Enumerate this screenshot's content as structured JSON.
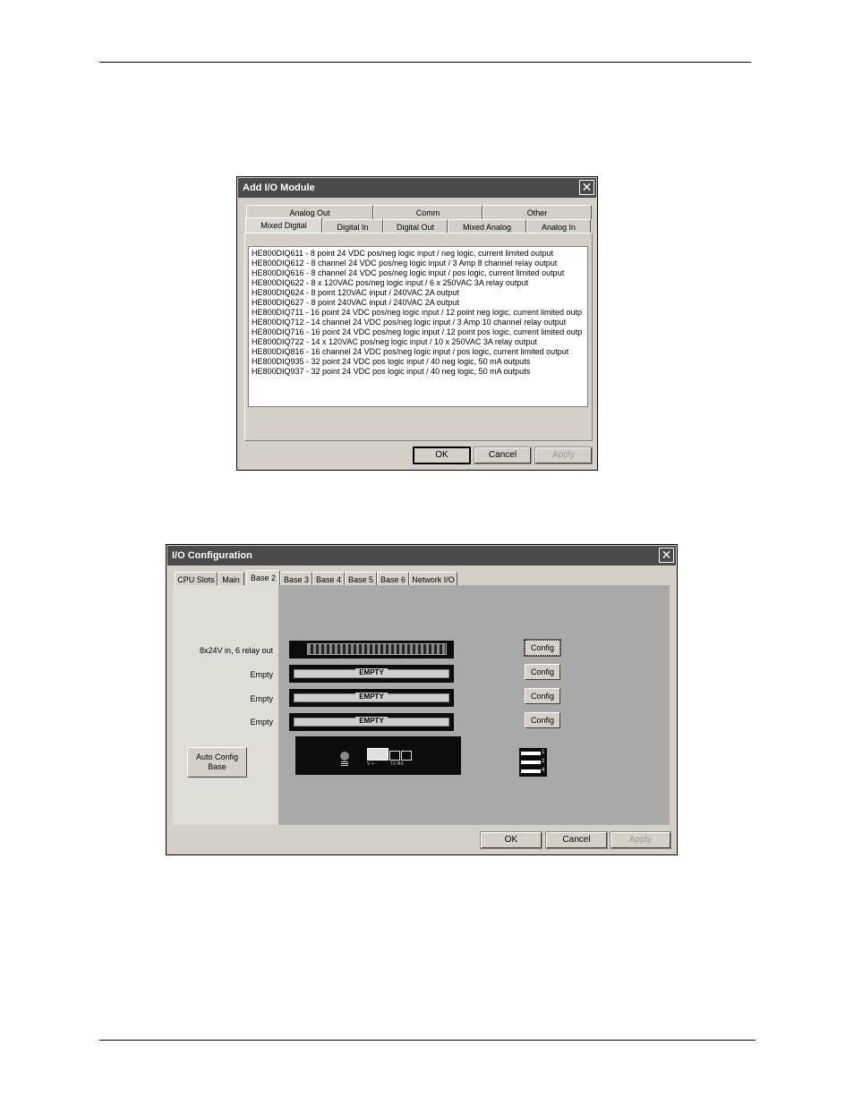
{
  "add_io_module": {
    "title": "Add I/O Module",
    "tabs_back": [
      "Analog Out",
      "Comm",
      "Other"
    ],
    "tabs_front": [
      "Mixed Digital",
      "Digital In",
      "Digital Out",
      "Mixed Analog",
      "Analog In"
    ],
    "active_tab": "Mixed Digital",
    "modules": [
      "HE800DIQ611  -  8 point 24 VDC pos/neg logic input / neg logic, current limited output",
      "HE800DIQ612  -  8 channel 24 VDC pos/neg logic input / 3 Amp 8 channel relay output",
      "HE800DIQ616  -  8 channel 24 VDC pos/neg logic input / pos logic, current limited output",
      "HE800DIQ622  -  8 x 120VAC pos/neg logic input / 6 x 250VAC 3A relay output",
      "HE800DIQ624  -  8 point 120VAC input / 240VAC 2A output",
      "HE800DIQ627  -  8 point 240VAC input / 240VAC 2A output",
      "HE800DIQ711  -  16 point 24 VDC pos/neg logic input / 12 point neg logic, current limited outp",
      "HE800DIQ712  -  14 channel 24 VDC pos/neg logic input / 3 Amp 10 channel relay output",
      "HE800DIQ716  -  16 point 24 VDC pos/neg logic input / 12 point pos logic, current limited outp",
      "HE800DIQ722  -  14 x 120VAC pos/neg logic input / 10 x 250VAC 3A relay output",
      "HE800DIQ816  -  16 channel 24 VDC pos/neg logic input / pos logic, current limited output",
      "HE800DIQ935  -  32 point 24 VDC pos logic input / 40 neg logic, 50 mA outputs",
      "HE800DIQ937  -  32 point 24 VDC pos logic input / 40 neg logic, 50 mA outputs"
    ],
    "buttons": {
      "ok": "OK",
      "cancel": "Cancel",
      "apply": "Apply"
    }
  },
  "io_config": {
    "title": "I/O Configuration",
    "tabs": [
      "CPU Slots",
      "Main",
      "Base 2",
      "Base 3",
      "Base 4",
      "Base 5",
      "Base 6",
      "Network I/O"
    ],
    "active_tab": "Base 2",
    "slots": [
      {
        "label": "8x24V in, 6 relay out",
        "module": "",
        "config": "Config"
      },
      {
        "label": "Empty",
        "module": "EMPTY",
        "config": "Config"
      },
      {
        "label": "Empty",
        "module": "EMPTY",
        "config": "Config"
      },
      {
        "label": "Empty",
        "module": "EMPTY",
        "config": "Config"
      }
    ],
    "auto_config": "Auto Config Base",
    "power_supply": {
      "port_labels": "TX  RX",
      "pin_labels": "V  +  -"
    },
    "dip_labels": [
      "1",
      "2",
      "4"
    ],
    "buttons": {
      "ok": "OK",
      "cancel": "Cancel",
      "apply": "Apply"
    }
  }
}
